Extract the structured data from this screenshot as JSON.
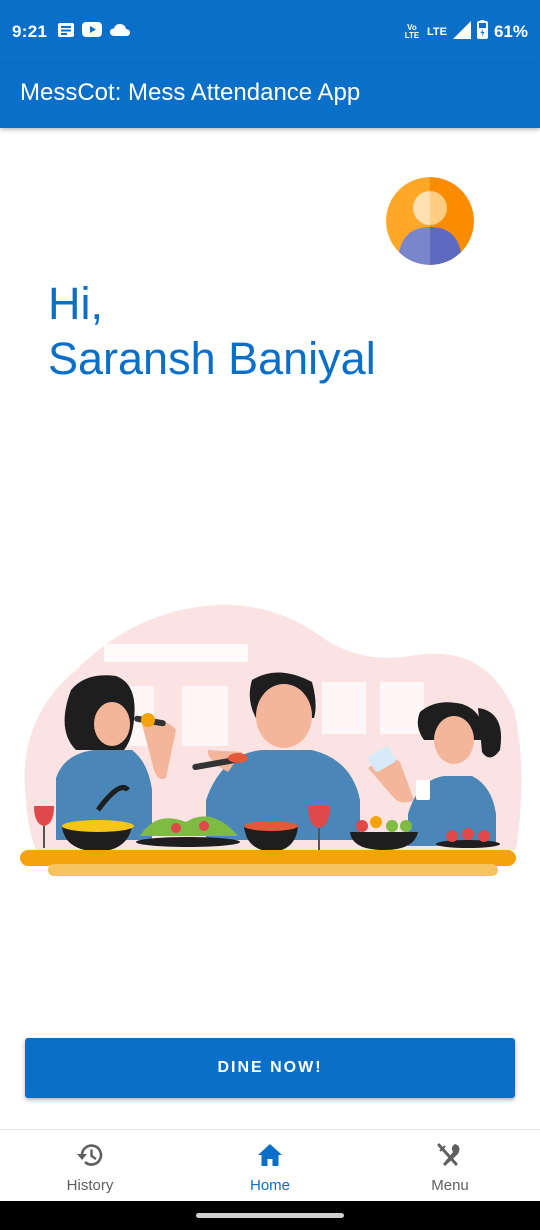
{
  "status_bar": {
    "time": "9:21",
    "volte": "Vo LTE",
    "network": "LTE",
    "battery": "61%",
    "icons": [
      "message-icon",
      "youtube-icon",
      "cloud-icon",
      "volte-icon",
      "signal-icon",
      "battery-icon"
    ]
  },
  "app_bar": {
    "title": "MessCot: Mess Attendance App"
  },
  "greeting": {
    "line1": "Hi,",
    "line2": "Saransh Baniyal"
  },
  "action": {
    "dine_label": "DINE NOW!"
  },
  "bottom_nav": {
    "items": [
      {
        "label": "History",
        "icon": "history-icon",
        "active": false
      },
      {
        "label": "Home",
        "icon": "home-icon",
        "active": true
      },
      {
        "label": "Menu",
        "icon": "restaurant-menu-icon",
        "active": false
      }
    ]
  },
  "colors": {
    "primary": "#0a6fc9",
    "inactive": "#5f5f5f",
    "illustration_bg": "#fbe3e3",
    "table": "#f5a30d"
  }
}
